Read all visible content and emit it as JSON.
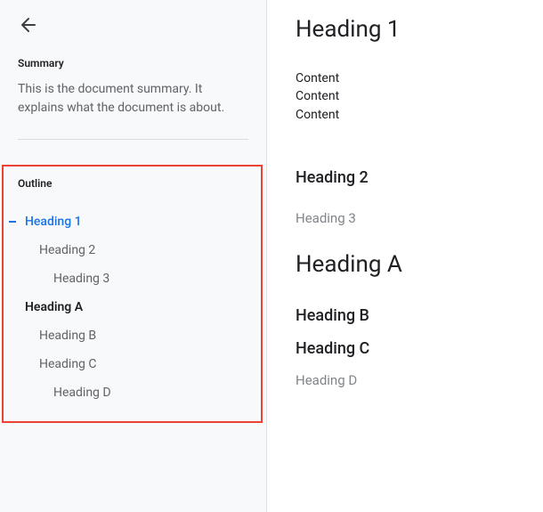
{
  "sidebar": {
    "summary_label": "Summary",
    "summary_text": "This is the document summary. It explains what the document is about.",
    "outline_label": "Outline",
    "items": [
      {
        "label": "Heading 1"
      },
      {
        "label": "Heading 2"
      },
      {
        "label": "Heading 3"
      },
      {
        "label": "Heading A"
      },
      {
        "label": "Heading B"
      },
      {
        "label": "Heading C"
      },
      {
        "label": "Heading D"
      }
    ]
  },
  "document": {
    "h1_a": "Heading 1",
    "content_lines": "Content\nContent\nContent",
    "h2_a": "Heading 2",
    "h3_a": "Heading 3",
    "h1_b": "Heading A",
    "h2_b": "Heading B",
    "h2_c": "Heading C",
    "h3_b": "Heading D"
  }
}
